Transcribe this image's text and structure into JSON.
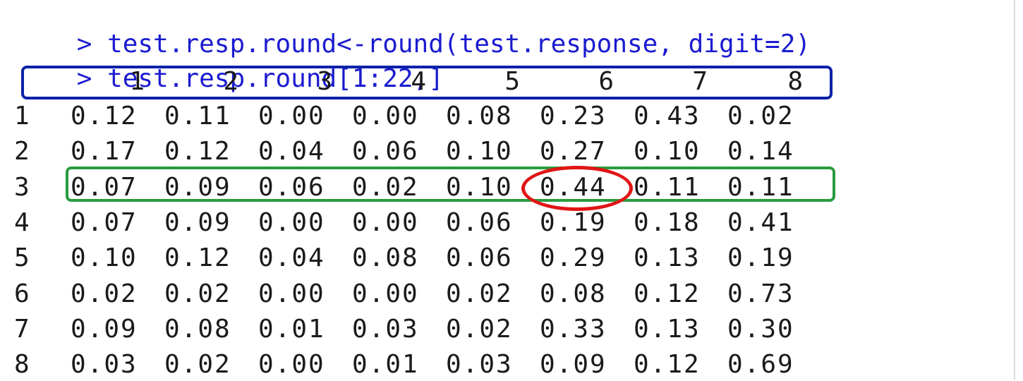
{
  "console": {
    "lines": [
      {
        "prompt": ">",
        "command": "test.resp.round<-round(test.response, digit=2)"
      },
      {
        "prompt": ">",
        "command": "test.resp.round[1:22,]"
      }
    ]
  },
  "table": {
    "column_headers": [
      "1",
      "2",
      "3",
      "4",
      "5",
      "6",
      "7",
      "8"
    ],
    "rows": [
      {
        "label": "1",
        "values": [
          "0.12",
          "0.11",
          "0.00",
          "0.00",
          "0.08",
          "0.23",
          "0.43",
          "0.02"
        ]
      },
      {
        "label": "2",
        "values": [
          "0.17",
          "0.12",
          "0.04",
          "0.06",
          "0.10",
          "0.27",
          "0.10",
          "0.14"
        ]
      },
      {
        "label": "3",
        "values": [
          "0.07",
          "0.09",
          "0.06",
          "0.02",
          "0.10",
          "0.44",
          "0.11",
          "0.11"
        ]
      },
      {
        "label": "4",
        "values": [
          "0.07",
          "0.09",
          "0.00",
          "0.00",
          "0.06",
          "0.19",
          "0.18",
          "0.41"
        ]
      },
      {
        "label": "5",
        "values": [
          "0.10",
          "0.12",
          "0.04",
          "0.08",
          "0.06",
          "0.29",
          "0.13",
          "0.19"
        ]
      },
      {
        "label": "6",
        "values": [
          "0.02",
          "0.02",
          "0.00",
          "0.00",
          "0.02",
          "0.08",
          "0.12",
          "0.73"
        ]
      },
      {
        "label": "7",
        "values": [
          "0.09",
          "0.08",
          "0.01",
          "0.03",
          "0.02",
          "0.33",
          "0.13",
          "0.30"
        ]
      },
      {
        "label": "8",
        "values": [
          "0.03",
          "0.02",
          "0.00",
          "0.01",
          "0.03",
          "0.09",
          "0.12",
          "0.69"
        ]
      }
    ]
  },
  "annotations": {
    "header_box_color": "#0a22a8",
    "row_box_color": "#2a9b3f",
    "cell_circle_color": "#e01515"
  }
}
